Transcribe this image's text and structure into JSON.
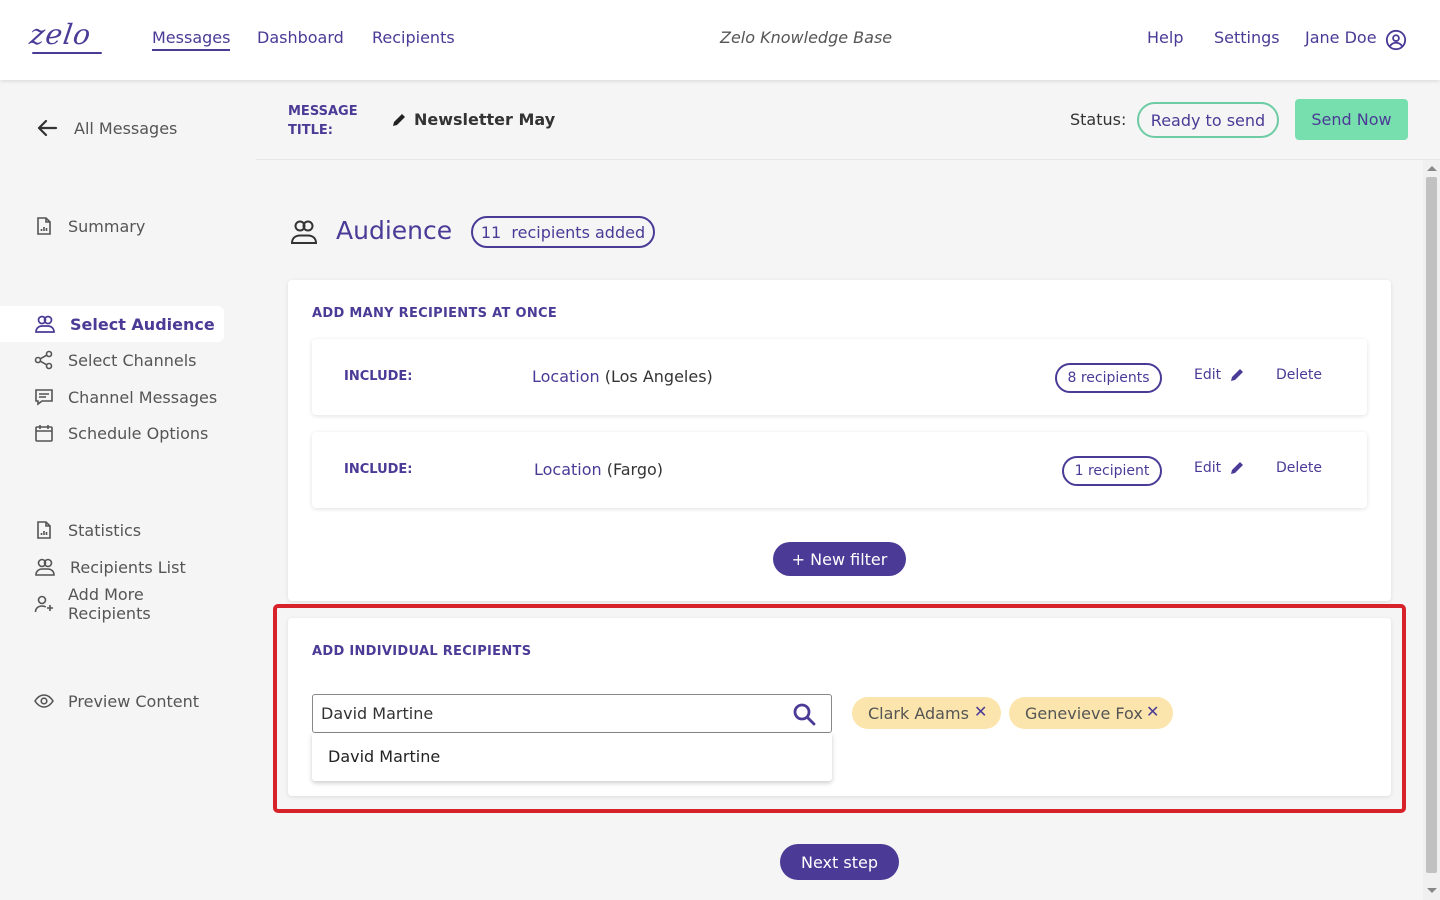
{
  "topbar": {
    "logo": "ZELO",
    "nav": [
      "Messages",
      "Dashboard",
      "Recipients"
    ],
    "knowledge_base": "Zelo Knowledge Base",
    "help": "Help",
    "settings": "Settings",
    "user": "Jane Doe"
  },
  "sidebar": {
    "back": "All Messages",
    "summary": "Summary",
    "select_audience": "Select Audience",
    "select_channels": "Select Channels",
    "channel_messages": "Channel Messages",
    "schedule_options": "Schedule Options",
    "statistics": "Statistics",
    "recipients_list": "Recipients List",
    "add_more_recipients": "Add More Recipients",
    "preview_content": "Preview Content"
  },
  "header": {
    "title_label": "MESSAGE TITLE:",
    "title": "Newsletter May",
    "status_label": "Status:",
    "status": "Ready to send",
    "send_now": "Send Now"
  },
  "audience": {
    "title": "Audience",
    "count_badge": "11  recipients added"
  },
  "many": {
    "heading": "ADD MANY RECIPIENTS AT ONCE",
    "filters": [
      {
        "include": "INCLUDE:",
        "key": "Location",
        "value": " (Los Angeles)",
        "count": "8 recipients",
        "edit": "Edit",
        "delete": "Delete"
      },
      {
        "include": "INCLUDE:",
        "key": "Location",
        "value": " (Fargo)",
        "count": "1 recipient",
        "edit": "Edit",
        "delete": "Delete"
      }
    ],
    "new_filter": "+ New filter"
  },
  "individual": {
    "heading": "ADD INDIVIDUAL RECIPIENTS",
    "search_value": "David Martine",
    "suggestion": "David Martine",
    "chips": [
      "Clark Adams",
      "Genevieve Fox"
    ],
    "chip_remove": "✕"
  },
  "next_step": "Next step",
  "colors": {
    "accent": "#4b3a96",
    "send": "#77dfae",
    "status_border": "#6dcca3",
    "chip": "#fbe5ac",
    "highlight": "#d8222a"
  }
}
